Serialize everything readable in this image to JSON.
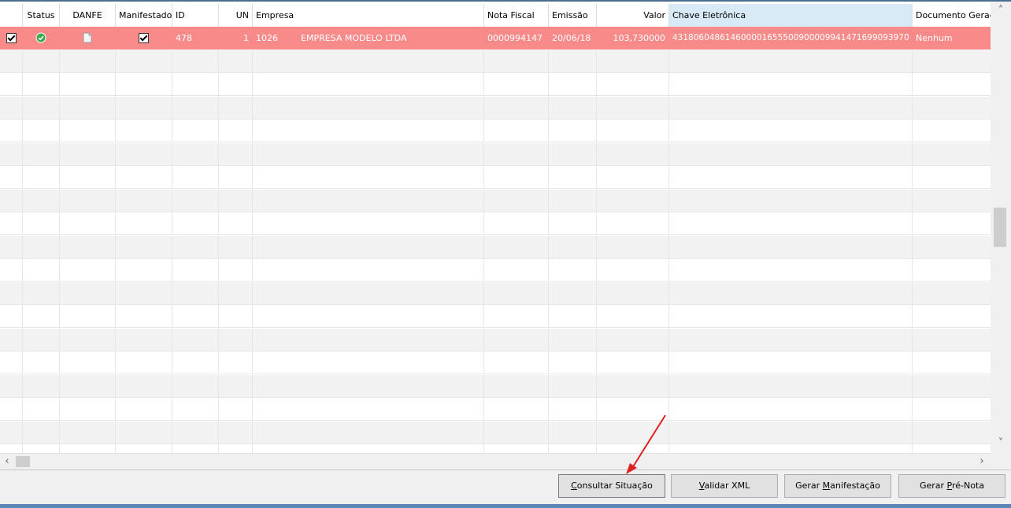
{
  "columns": [
    {
      "key": "check",
      "label": "",
      "left": 0,
      "width": 29
    },
    {
      "key": "status",
      "label": "Status"
    },
    {
      "key": "danfe",
      "label": "DANFE"
    },
    {
      "key": "manifestado",
      "label": "Manifestado"
    },
    {
      "key": "id",
      "label": "ID"
    },
    {
      "key": "un",
      "label": "UN"
    },
    {
      "key": "empresa",
      "label": "Empresa"
    },
    {
      "key": "nota",
      "label": "Nota Fiscal"
    },
    {
      "key": "emissao",
      "label": "Emissão"
    },
    {
      "key": "valor",
      "label": "Valor"
    },
    {
      "key": "chave",
      "label": "Chave Eletrônica"
    },
    {
      "key": "documento",
      "label": "Documento Gerac"
    }
  ],
  "selected_row": {
    "checked": true,
    "status_icon": "check-circle-icon",
    "danfe_icon": "document-icon",
    "manifestado": true,
    "id": "478",
    "un": "1",
    "empresa_code": "1026",
    "empresa_name": "EMPRESA MODELO LTDA",
    "nota": "0000994147",
    "emissao": "20/06/18",
    "valor": "103,730000",
    "chave": "43180604861460000165550090000994147169909397",
    "chave_suffix": "0",
    "documento": "Nenhum"
  },
  "buttons": {
    "consultar": {
      "pre": "",
      "u": "C",
      "post": "onsultar Situação"
    },
    "validar": {
      "pre": "",
      "u": "V",
      "post": "alidar XML"
    },
    "manifestacao": {
      "pre": "Gerar ",
      "u": "M",
      "post": "anifestação"
    },
    "prenota": {
      "pre": "Gerar ",
      "u": "P",
      "post": "ré-Nota"
    }
  },
  "colors": {
    "selected_row": "#f88a8a",
    "highlight_header": "#d9eaf7",
    "annotation_arrow": "#e02020"
  }
}
